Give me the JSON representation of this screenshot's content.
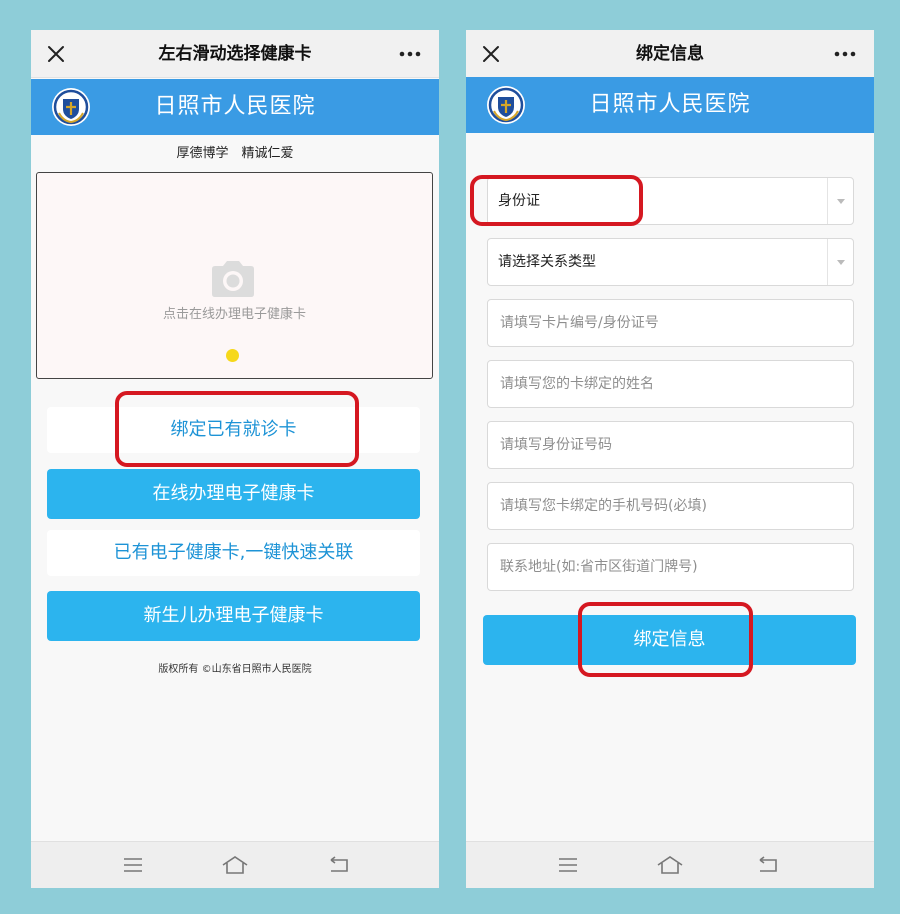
{
  "left_screen": {
    "title": "左右滑动选择健康卡",
    "hospital_name": "日照市人民医院",
    "motto": "厚德博学　精诚仁爱",
    "card_hint": "点击在线办理电子健康卡",
    "buttons": {
      "bind_existing": "绑定已有就诊卡",
      "apply_online": "在线办理电子健康卡",
      "quick_link": "已有电子健康卡,一键快速关联",
      "newborn": "新生儿办理电子健康卡"
    },
    "copyright": "版权所有 ©山东省日照市人民医院"
  },
  "right_screen": {
    "title": "绑定信息",
    "hospital_name": "日照市人民医院",
    "id_type": "身份证",
    "relation_type": "请选择关系类型",
    "fields": {
      "card_number": "请填写卡片编号/身份证号",
      "name": "请填写您的卡绑定的姓名",
      "id_number": "请填写身份证号码",
      "phone": "请填写您卡绑定的手机号码(必填)",
      "address": "联系地址(如:省市区街道门牌号)"
    },
    "submit": "绑定信息"
  },
  "colors": {
    "background": "#8ecdd8",
    "banner": "#3a9be4",
    "button_blue": "#2cb4ee",
    "link_text": "#1d93d6",
    "highlight": "#d51821",
    "indicator_dot": "#f6d81a"
  },
  "icons": [
    "close-icon",
    "more-icon",
    "hospital-logo",
    "camera-icon",
    "menu-icon",
    "home-icon",
    "back-icon",
    "chevron-down-icon"
  ]
}
